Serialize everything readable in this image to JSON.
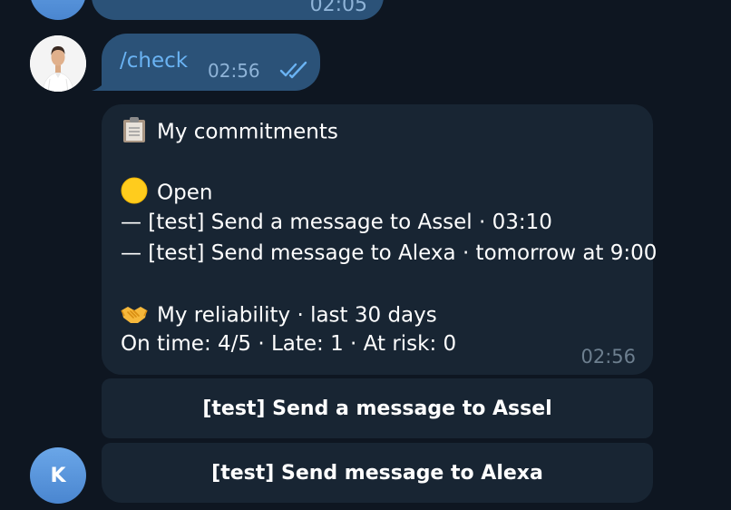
{
  "previous_message": {
    "time": "02:05"
  },
  "outgoing_message": {
    "text": "/check",
    "time": "02:56",
    "status_icon": "double-check-icon"
  },
  "bot_message": {
    "lines": [
      {
        "emoji": "clipboard",
        "text": "My commitments"
      },
      {
        "emoji": "yellow-circle",
        "text": "Open"
      },
      {
        "text": "— [test] Send a message to Assel · 03:10"
      },
      {
        "text": "— [test] Send message to Alexa · tomorrow at 9:00"
      },
      {
        "emoji": "handshake",
        "text": "My reliability · last 30 days"
      },
      {
        "text": "On time: 4/5 · Late: 1 · At risk: 0"
      }
    ],
    "time": "02:56"
  },
  "inline_keyboard": {
    "buttons": [
      {
        "label": "[test] Send a message to Assel"
      },
      {
        "label": "[test] Send message to Alexa"
      }
    ]
  },
  "avatars": {
    "bot_initial": "K"
  },
  "colors": {
    "background": "#0e1621",
    "outgoing_bubble": "#2b5278",
    "incoming_bubble": "#182533",
    "accent": "#6ab3f3"
  }
}
